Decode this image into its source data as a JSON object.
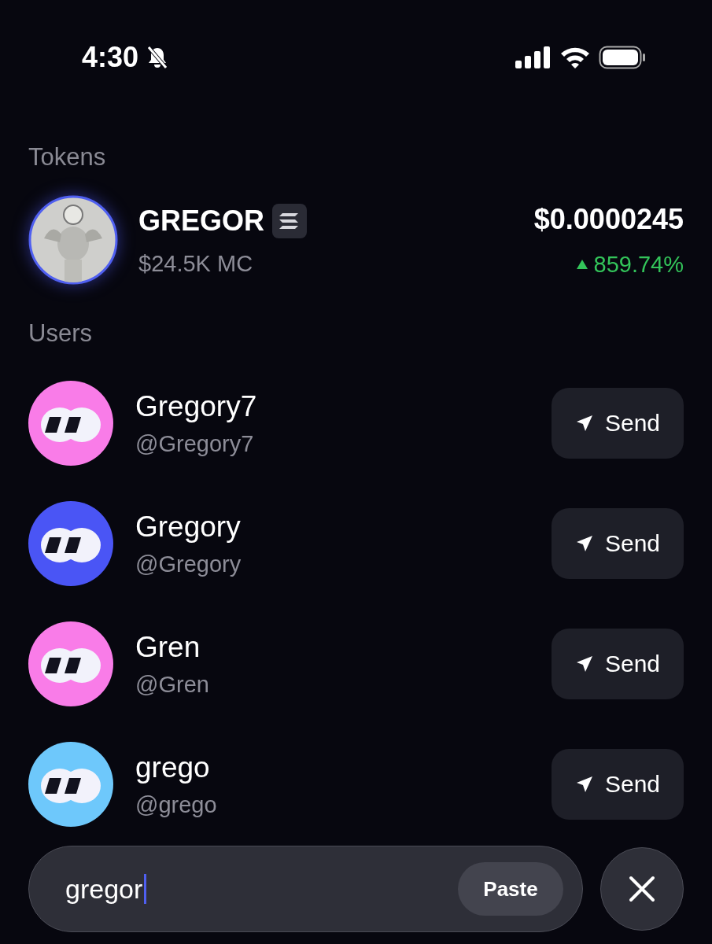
{
  "status_bar": {
    "time": "4:30",
    "silenced": true
  },
  "tokens": {
    "heading": "Tokens",
    "items": [
      {
        "name": "GREGOR",
        "market_cap": "$24.5K MC",
        "price": "$0.0000245",
        "change": "859.74%",
        "rising": true
      }
    ]
  },
  "users": {
    "heading": "Users",
    "items": [
      {
        "kind": "full",
        "name": "Gregory7",
        "handle": "@Gregory7",
        "color": "#f97ce8",
        "action": "Send"
      },
      {
        "kind": "full",
        "name": "Gregory",
        "handle": "@Gregory",
        "color": "#4a55f5",
        "action": "Send"
      },
      {
        "kind": "full",
        "name": "Gren",
        "handle": "@Gren",
        "color": "#f97ce8",
        "action": "Send"
      },
      {
        "kind": "full",
        "name": "grego",
        "handle": "@grego",
        "color": "#6ec8fb",
        "action": "Send"
      }
    ]
  },
  "search": {
    "value": "gregor",
    "paste": "Paste"
  }
}
